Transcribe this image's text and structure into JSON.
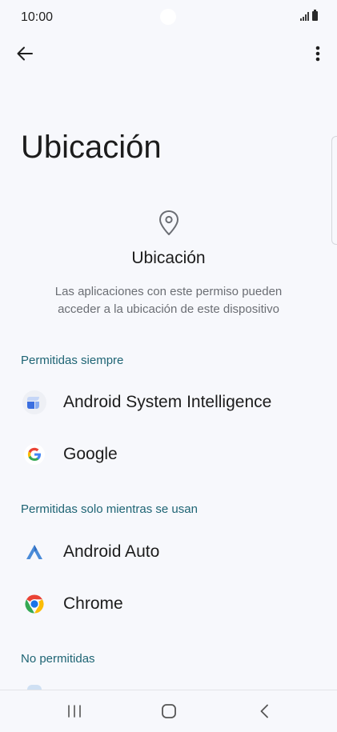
{
  "status_bar": {
    "time": "10:00"
  },
  "page": {
    "title": "Ubicación"
  },
  "header": {
    "icon": "location-pin-icon",
    "title": "Ubicación",
    "description": "Las aplicaciones con este permiso pueden acceder a la ubicación de este dispositivo"
  },
  "sections": {
    "always": {
      "label": "Permitidas siempre",
      "apps": [
        {
          "label": "Android System Intelligence",
          "icon": "android-system-intelligence-icon"
        },
        {
          "label": "Google",
          "icon": "google-icon"
        }
      ]
    },
    "while_in_use": {
      "label": "Permitidas solo mientras se usan",
      "apps": [
        {
          "label": "Android Auto",
          "icon": "android-auto-icon"
        },
        {
          "label": "Chrome",
          "icon": "chrome-icon"
        }
      ]
    },
    "denied": {
      "label": "No permitidas"
    }
  },
  "colors": {
    "background": "#f7f8fc",
    "section_header": "#1e6474",
    "secondary_text": "#6b6e74"
  }
}
